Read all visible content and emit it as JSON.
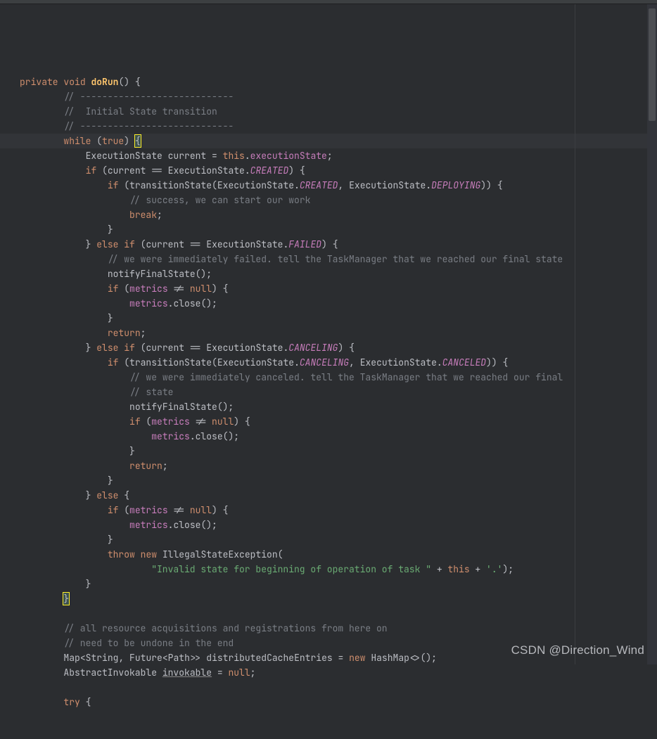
{
  "watermark": "CSDN @Direction_Wind",
  "code": {
    "lines": [
      {
        "i": 0,
        "t": "blank"
      },
      {
        "i": 0,
        "t": "sig"
      },
      {
        "i": 1,
        "t": "c",
        "v": "// ----------------------------"
      },
      {
        "i": 1,
        "t": "c",
        "v": "//  Initial State transition"
      },
      {
        "i": 1,
        "t": "c",
        "v": "// ----------------------------"
      },
      {
        "i": 1,
        "t": "while",
        "hl": true
      },
      {
        "i": 2,
        "t": "assign"
      },
      {
        "i": 2,
        "t": "if_created"
      },
      {
        "i": 3,
        "t": "trans_created"
      },
      {
        "i": 4,
        "t": "c",
        "v": "// success, we can start our work",
        "g": 3
      },
      {
        "i": 4,
        "t": "break",
        "g": 3
      },
      {
        "i": 3,
        "t": "rb",
        "g": 2
      },
      {
        "i": 2,
        "t": "elseif_failed"
      },
      {
        "i": 3,
        "t": "c",
        "v": "// we were immediately failed. tell the TaskManager that we reached our final state",
        "g": 2
      },
      {
        "i": 3,
        "t": "notify",
        "g": 2
      },
      {
        "i": 3,
        "t": "if_metrics",
        "g": 2
      },
      {
        "i": 4,
        "t": "metrics_close",
        "g": 3
      },
      {
        "i": 3,
        "t": "rb",
        "g": 2
      },
      {
        "i": 3,
        "t": "return",
        "g": 2
      },
      {
        "i": 2,
        "t": "elseif_canceling"
      },
      {
        "i": 3,
        "t": "trans_canceling"
      },
      {
        "i": 4,
        "t": "c",
        "v": "// we were immediately canceled. tell the TaskManager that we reached our final",
        "g": 3
      },
      {
        "i": 4,
        "t": "c",
        "v": "// state",
        "g": 3
      },
      {
        "i": 4,
        "t": "notify",
        "g": 3
      },
      {
        "i": 4,
        "t": "if_metrics",
        "g": 3
      },
      {
        "i": 5,
        "t": "metrics_close",
        "g": 4
      },
      {
        "i": 4,
        "t": "rb",
        "g": 3
      },
      {
        "i": 4,
        "t": "return",
        "g": 3
      },
      {
        "i": 3,
        "t": "rb",
        "g": 2
      },
      {
        "i": 2,
        "t": "else"
      },
      {
        "i": 3,
        "t": "if_metrics",
        "g": 2
      },
      {
        "i": 4,
        "t": "metrics_close",
        "g": 3
      },
      {
        "i": 3,
        "t": "rb",
        "g": 2
      },
      {
        "i": 3,
        "t": "throw",
        "g": 2
      },
      {
        "i": 5,
        "t": "str",
        "v": "\"Invalid state for beginning of operation of task \""
      },
      {
        "i": 2,
        "t": "rb",
        "g": 1
      },
      {
        "i": 1,
        "t": "rb_end"
      },
      {
        "i": 0,
        "t": "blank"
      },
      {
        "i": 1,
        "t": "c",
        "v": "// all resource acquisitions and registrations from here on"
      },
      {
        "i": 1,
        "t": "c",
        "v": "// need to be undone in the end"
      },
      {
        "i": 1,
        "t": "map_decl"
      },
      {
        "i": 1,
        "t": "invokable_decl"
      },
      {
        "i": 0,
        "t": "blank"
      },
      {
        "i": 1,
        "t": "try"
      }
    ],
    "tokens": {
      "private": "private",
      "void": "void",
      "doRun": "doRun",
      "while": "while",
      "true": "true",
      "ExecutionState": "ExecutionState",
      "current": "current",
      "this": "this",
      "executionState": "executionState",
      "if": "if",
      "else": "else",
      "transitionState": "transitionState",
      "CREATED": "CREATED",
      "DEPLOYING": "DEPLOYING",
      "FAILED": "FAILED",
      "CANCELING": "CANCELING",
      "CANCELED": "CANCELED",
      "break": "break",
      "notifyFinalState": "notifyFinalState",
      "metrics": "metrics",
      "null": "null",
      "close": "close",
      "return": "return",
      "throw": "throw",
      "new": "new",
      "IllegalStateException": "IllegalStateException",
      "Map": "Map",
      "String": "String",
      "Future": "Future",
      "Path": "Path",
      "distributedCacheEntries": "distributedCacheEntries",
      "HashMap": "HashMap",
      "AbstractInvokable": "AbstractInvokable",
      "invokable": "invokable",
      "try": "try"
    }
  }
}
